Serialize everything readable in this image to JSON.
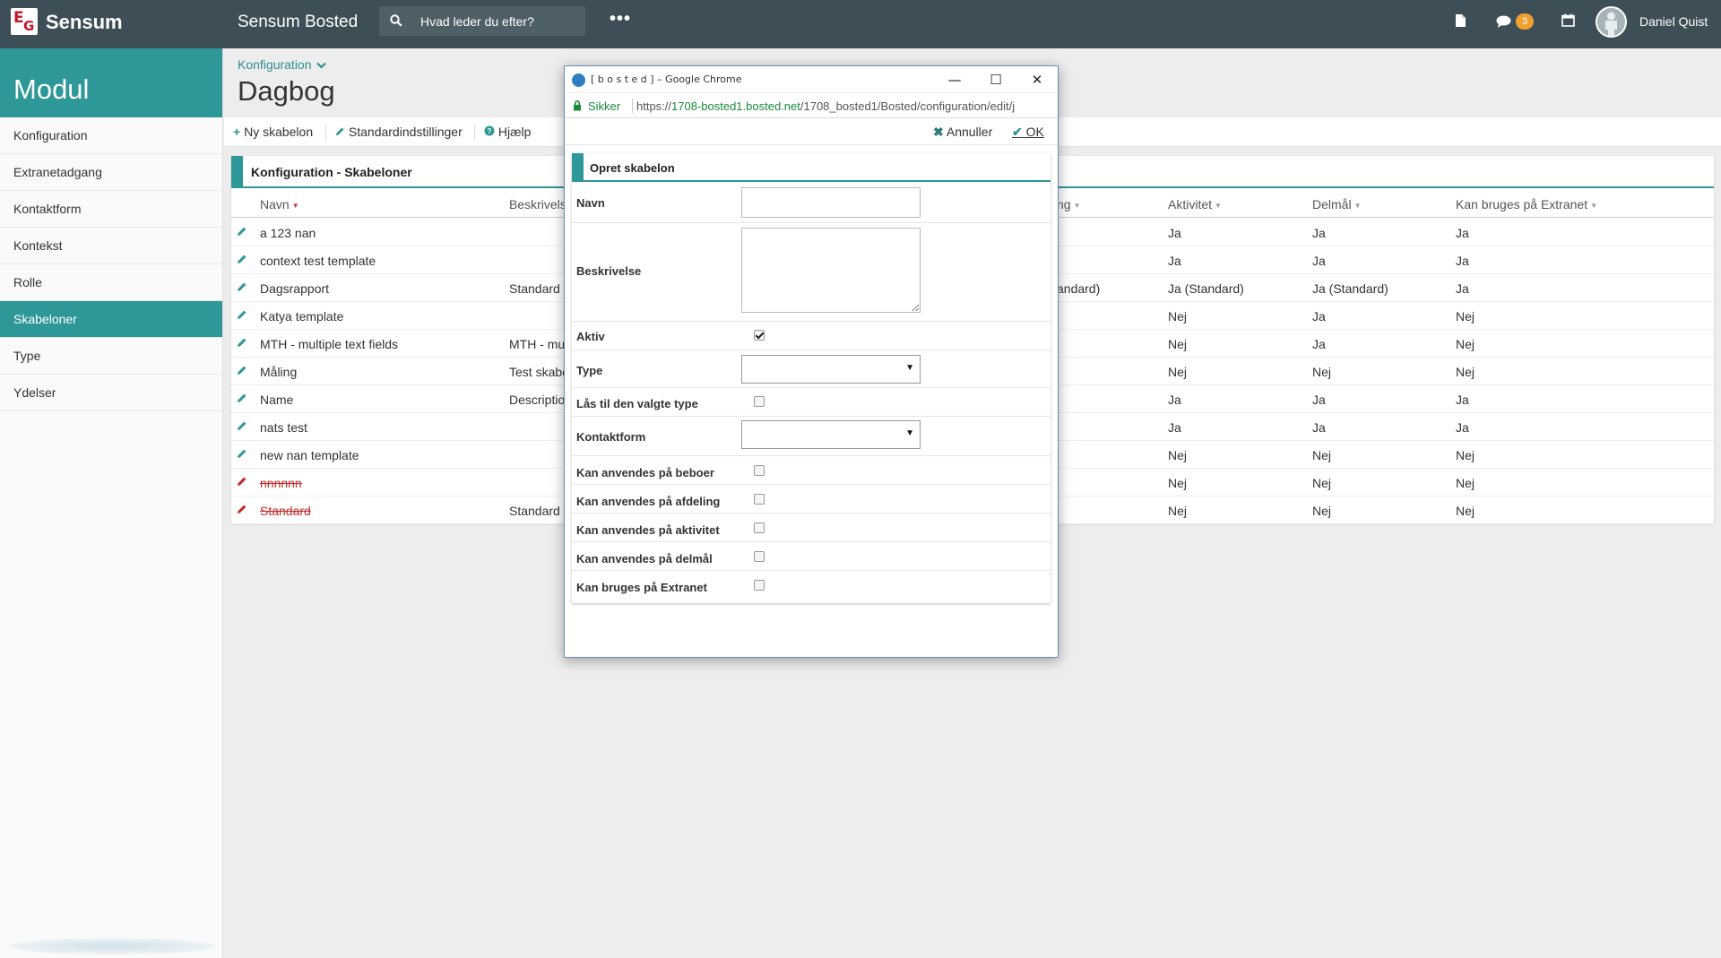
{
  "topbar": {
    "brand": "Sensum",
    "app_title": "Sensum Bosted",
    "search_placeholder": "Hvad leder du efter?",
    "more": "•••",
    "notification_count": "3",
    "user_name": "Daniel Quist"
  },
  "sidebar": {
    "title": "Modul",
    "items": [
      {
        "label": "Konfiguration"
      },
      {
        "label": "Extranetadgang"
      },
      {
        "label": "Kontaktform"
      },
      {
        "label": "Kontekst"
      },
      {
        "label": "Rolle"
      },
      {
        "label": "Skabeloner",
        "active": true
      },
      {
        "label": "Type"
      },
      {
        "label": "Ydelser"
      }
    ]
  },
  "main": {
    "breadcrumb": "Konfiguration",
    "title": "Dagbog",
    "toolbar": {
      "new": "Ny skabelon",
      "defaults": "Standardindstillinger",
      "help": "Hjælp"
    },
    "panel_title": "Konfiguration - Skabeloner",
    "columns": {
      "navn": "Navn",
      "beskrivelse": "Beskrivels",
      "hidden_partial": "ng",
      "aktivitet": "Aktivitet",
      "delmaal": "Delmål",
      "extranet": "Kan bruges på Extranet"
    },
    "rows": [
      {
        "navn": "a 123 nan",
        "beskrivelse": "",
        "partial": "",
        "aktivitet": "Ja",
        "delmaal": "Ja",
        "extranet": "Ja"
      },
      {
        "navn": "context test template",
        "beskrivelse": "",
        "partial": "",
        "aktivitet": "Ja",
        "delmaal": "Ja",
        "extranet": "Ja"
      },
      {
        "navn": "Dagsrapport",
        "beskrivelse": "Standard",
        "partial": "andard)",
        "aktivitet": "Ja (Standard)",
        "delmaal": "Ja (Standard)",
        "extranet": "Ja"
      },
      {
        "navn": "Katya template",
        "beskrivelse": "",
        "partial": "",
        "aktivitet": "Nej",
        "delmaal": "Ja",
        "extranet": "Nej"
      },
      {
        "navn": "MTH - multiple text fields",
        "beskrivelse": "MTH - mu",
        "partial": "",
        "aktivitet": "Nej",
        "delmaal": "Ja",
        "extranet": "Nej"
      },
      {
        "navn": "Måling",
        "beskrivelse": "Test skabe",
        "partial": "",
        "aktivitet": "Nej",
        "delmaal": "Nej",
        "extranet": "Nej"
      },
      {
        "navn": "Name",
        "beskrivelse": "Descriptio",
        "partial": "",
        "aktivitet": "Ja",
        "delmaal": "Ja",
        "extranet": "Ja"
      },
      {
        "navn": "nats test",
        "beskrivelse": "",
        "partial": "",
        "aktivitet": "Ja",
        "delmaal": "Ja",
        "extranet": "Ja"
      },
      {
        "navn": "new nan template",
        "beskrivelse": "",
        "partial": "",
        "aktivitet": "Nej",
        "delmaal": "Nej",
        "extranet": "Nej"
      },
      {
        "navn": "nnnnnn",
        "beskrivelse": "",
        "partial": "",
        "aktivitet": "Nej",
        "delmaal": "Nej",
        "extranet": "Nej",
        "deleted": true
      },
      {
        "navn": "Standard",
        "beskrivelse": "Standard",
        "partial": "",
        "aktivitet": "Nej",
        "delmaal": "Nej",
        "extranet": "Nej",
        "deleted": true
      }
    ]
  },
  "popup": {
    "window_title": "[ b o s t e d ] – Google Chrome",
    "secure_label": "Sikker",
    "url_scheme": "https://",
    "url_host": "1708-bosted1.bosted.net",
    "url_path": "/1708_bosted1/Bosted/configuration/edit/j",
    "cancel": "Annuller",
    "ok": "OK",
    "form_title": "Opret skabelon",
    "fields": {
      "navn": "Navn",
      "beskrivelse": "Beskrivelse",
      "aktiv": "Aktiv",
      "type": "Type",
      "laas": "Lås til den valgte type",
      "kontaktform": "Kontaktform",
      "beboer": "Kan anvendes på beboer",
      "afdeling": "Kan anvendes på afdeling",
      "aktivitet": "Kan anvendes på aktivitet",
      "delmaal": "Kan anvendes på delmål",
      "extranet": "Kan bruges på Extranet"
    },
    "values": {
      "navn": "",
      "beskrivelse": "",
      "aktiv": true,
      "type": "",
      "laas": false,
      "kontaktform": "",
      "beboer": false,
      "afdeling": false,
      "aktivitet": false,
      "delmaal": false,
      "extranet": false
    }
  },
  "colors": {
    "topbar": "#3d4e57",
    "accent": "#2e9797",
    "brand_red": "#c4162a",
    "badge": "#f0a030",
    "deleted_text": "#c62828"
  }
}
